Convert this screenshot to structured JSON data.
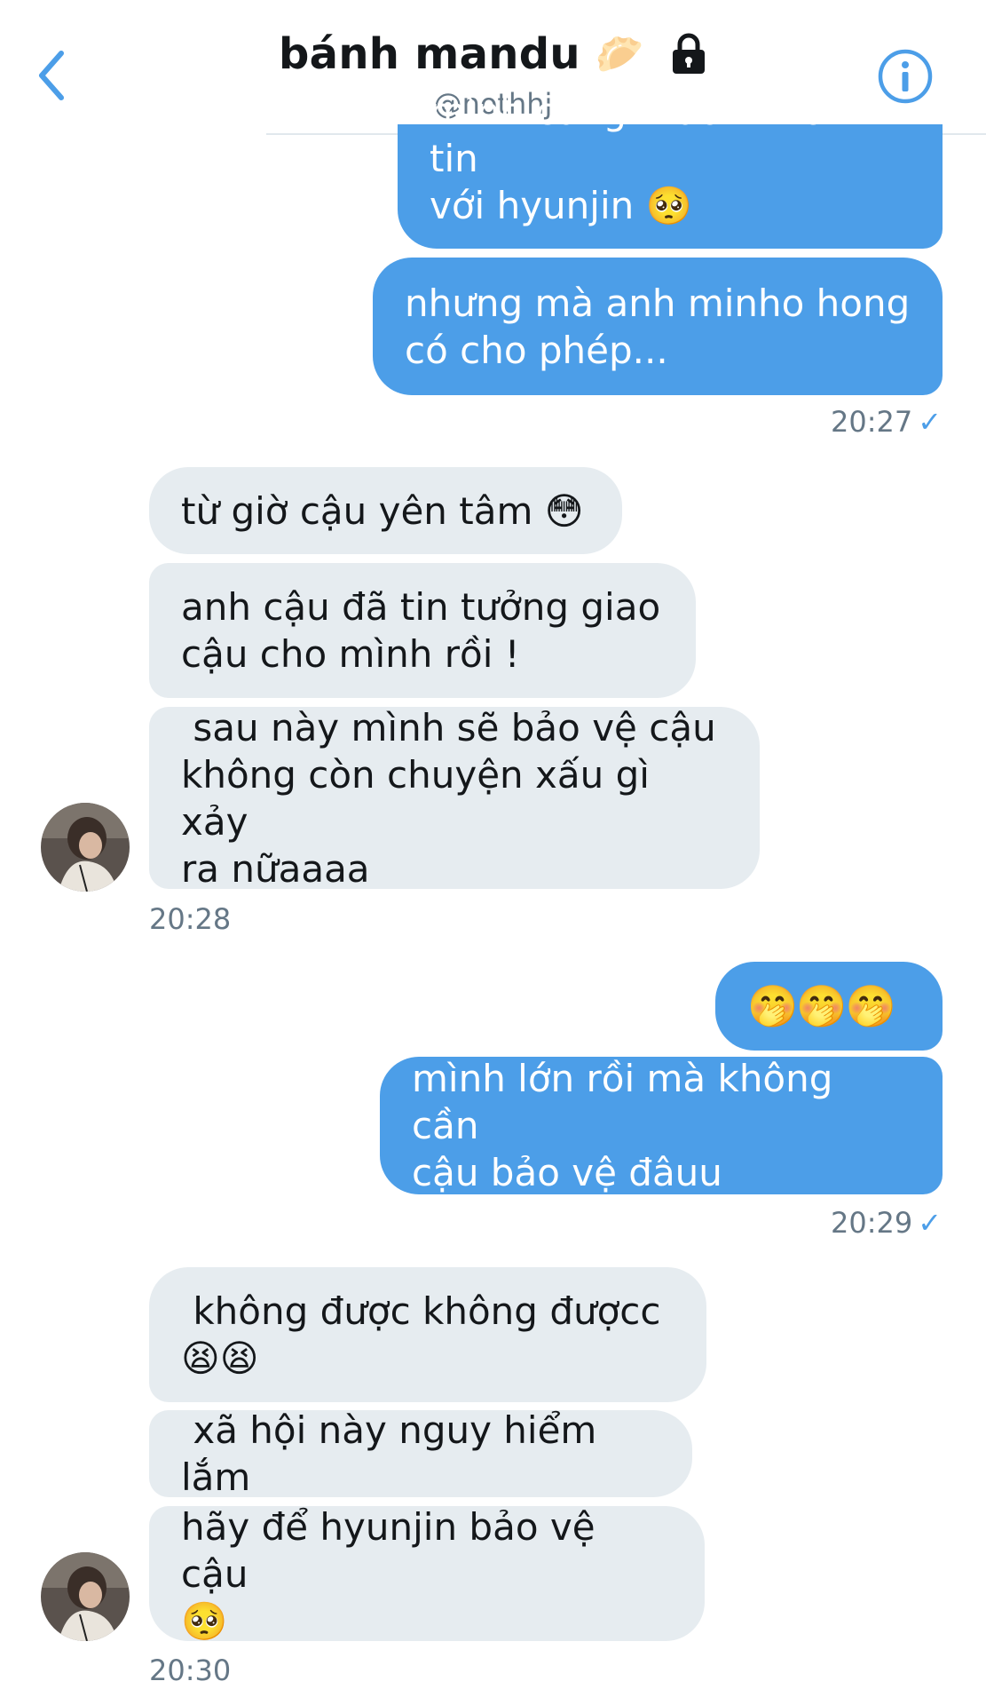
{
  "header": {
    "title": "bánh mandu",
    "title_emoji": "🥟",
    "handle": "@nothhj"
  },
  "colors": {
    "accent": "#4c9ee8",
    "incoming_bubble": "#e6ecf0",
    "timestamp": "#657786"
  },
  "messages": [
    {
      "direction": "outgoing",
      "text": "mình cũng muốn nhắn tin\nvới hyunjin 🥺"
    },
    {
      "direction": "outgoing",
      "text": "nhưng mà anh minho hong\ncó cho phép..."
    },
    {
      "direction": "outgoing",
      "time": "20:27",
      "status": "✓"
    },
    {
      "direction": "incoming",
      "text": "từ giờ cậu yên tâm 😳"
    },
    {
      "direction": "incoming",
      "text": "anh cậu đã tin tưởng giao\ncậu cho mình rồi !"
    },
    {
      "direction": "incoming",
      "text": " sau này mình sẽ bảo vệ cậu\nkhông còn chuyện xấu gì xảy\nra nữaaaa"
    },
    {
      "direction": "incoming",
      "time": "20:28"
    },
    {
      "direction": "outgoing",
      "text": "🤭🤭🤭"
    },
    {
      "direction": "outgoing",
      "text": "mình lớn rồi mà không cần\ncậu bảo vệ đâuu"
    },
    {
      "direction": "outgoing",
      "time": "20:29",
      "status": "✓"
    },
    {
      "direction": "incoming",
      "text": " không được không đượcc\n😫😫"
    },
    {
      "direction": "incoming",
      "text": " xã hội này nguy hiểm lắm"
    },
    {
      "direction": "incoming",
      "text": "hãy để hyunjin bảo vệ cậu\n🥺"
    },
    {
      "direction": "incoming",
      "time": "20:30"
    }
  ]
}
